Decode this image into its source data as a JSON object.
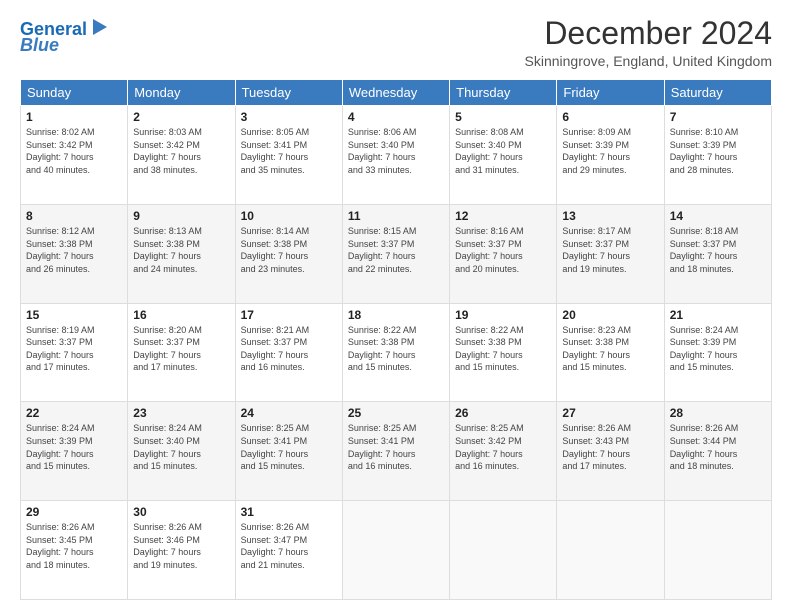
{
  "header": {
    "logo_line1": "General",
    "logo_line2": "Blue",
    "month_title": "December 2024",
    "location": "Skinningrove, England, United Kingdom"
  },
  "days_of_week": [
    "Sunday",
    "Monday",
    "Tuesday",
    "Wednesday",
    "Thursday",
    "Friday",
    "Saturday"
  ],
  "weeks": [
    [
      {
        "day": "1",
        "sunrise": "8:02 AM",
        "sunset": "3:42 PM",
        "daylight": "7 hours and 40 minutes."
      },
      {
        "day": "2",
        "sunrise": "8:03 AM",
        "sunset": "3:42 PM",
        "daylight": "7 hours and 38 minutes."
      },
      {
        "day": "3",
        "sunrise": "8:05 AM",
        "sunset": "3:41 PM",
        "daylight": "7 hours and 35 minutes."
      },
      {
        "day": "4",
        "sunrise": "8:06 AM",
        "sunset": "3:40 PM",
        "daylight": "7 hours and 33 minutes."
      },
      {
        "day": "5",
        "sunrise": "8:08 AM",
        "sunset": "3:40 PM",
        "daylight": "7 hours and 31 minutes."
      },
      {
        "day": "6",
        "sunrise": "8:09 AM",
        "sunset": "3:39 PM",
        "daylight": "7 hours and 29 minutes."
      },
      {
        "day": "7",
        "sunrise": "8:10 AM",
        "sunset": "3:39 PM",
        "daylight": "7 hours and 28 minutes."
      }
    ],
    [
      {
        "day": "8",
        "sunrise": "8:12 AM",
        "sunset": "3:38 PM",
        "daylight": "7 hours and 26 minutes."
      },
      {
        "day": "9",
        "sunrise": "8:13 AM",
        "sunset": "3:38 PM",
        "daylight": "7 hours and 24 minutes."
      },
      {
        "day": "10",
        "sunrise": "8:14 AM",
        "sunset": "3:38 PM",
        "daylight": "7 hours and 23 minutes."
      },
      {
        "day": "11",
        "sunrise": "8:15 AM",
        "sunset": "3:37 PM",
        "daylight": "7 hours and 22 minutes."
      },
      {
        "day": "12",
        "sunrise": "8:16 AM",
        "sunset": "3:37 PM",
        "daylight": "7 hours and 20 minutes."
      },
      {
        "day": "13",
        "sunrise": "8:17 AM",
        "sunset": "3:37 PM",
        "daylight": "7 hours and 19 minutes."
      },
      {
        "day": "14",
        "sunrise": "8:18 AM",
        "sunset": "3:37 PM",
        "daylight": "7 hours and 18 minutes."
      }
    ],
    [
      {
        "day": "15",
        "sunrise": "8:19 AM",
        "sunset": "3:37 PM",
        "daylight": "7 hours and 17 minutes."
      },
      {
        "day": "16",
        "sunrise": "8:20 AM",
        "sunset": "3:37 PM",
        "daylight": "7 hours and 17 minutes."
      },
      {
        "day": "17",
        "sunrise": "8:21 AM",
        "sunset": "3:37 PM",
        "daylight": "7 hours and 16 minutes."
      },
      {
        "day": "18",
        "sunrise": "8:22 AM",
        "sunset": "3:38 PM",
        "daylight": "7 hours and 15 minutes."
      },
      {
        "day": "19",
        "sunrise": "8:22 AM",
        "sunset": "3:38 PM",
        "daylight": "7 hours and 15 minutes."
      },
      {
        "day": "20",
        "sunrise": "8:23 AM",
        "sunset": "3:38 PM",
        "daylight": "7 hours and 15 minutes."
      },
      {
        "day": "21",
        "sunrise": "8:24 AM",
        "sunset": "3:39 PM",
        "daylight": "7 hours and 15 minutes."
      }
    ],
    [
      {
        "day": "22",
        "sunrise": "8:24 AM",
        "sunset": "3:39 PM",
        "daylight": "7 hours and 15 minutes."
      },
      {
        "day": "23",
        "sunrise": "8:24 AM",
        "sunset": "3:40 PM",
        "daylight": "7 hours and 15 minutes."
      },
      {
        "day": "24",
        "sunrise": "8:25 AM",
        "sunset": "3:41 PM",
        "daylight": "7 hours and 15 minutes."
      },
      {
        "day": "25",
        "sunrise": "8:25 AM",
        "sunset": "3:41 PM",
        "daylight": "7 hours and 16 minutes."
      },
      {
        "day": "26",
        "sunrise": "8:25 AM",
        "sunset": "3:42 PM",
        "daylight": "7 hours and 16 minutes."
      },
      {
        "day": "27",
        "sunrise": "8:26 AM",
        "sunset": "3:43 PM",
        "daylight": "7 hours and 17 minutes."
      },
      {
        "day": "28",
        "sunrise": "8:26 AM",
        "sunset": "3:44 PM",
        "daylight": "7 hours and 18 minutes."
      }
    ],
    [
      {
        "day": "29",
        "sunrise": "8:26 AM",
        "sunset": "3:45 PM",
        "daylight": "7 hours and 18 minutes."
      },
      {
        "day": "30",
        "sunrise": "8:26 AM",
        "sunset": "3:46 PM",
        "daylight": "7 hours and 19 minutes."
      },
      {
        "day": "31",
        "sunrise": "8:26 AM",
        "sunset": "3:47 PM",
        "daylight": "7 hours and 21 minutes."
      },
      null,
      null,
      null,
      null
    ]
  ],
  "labels": {
    "sunrise": "Sunrise:",
    "sunset": "Sunset:",
    "daylight": "Daylight:"
  }
}
